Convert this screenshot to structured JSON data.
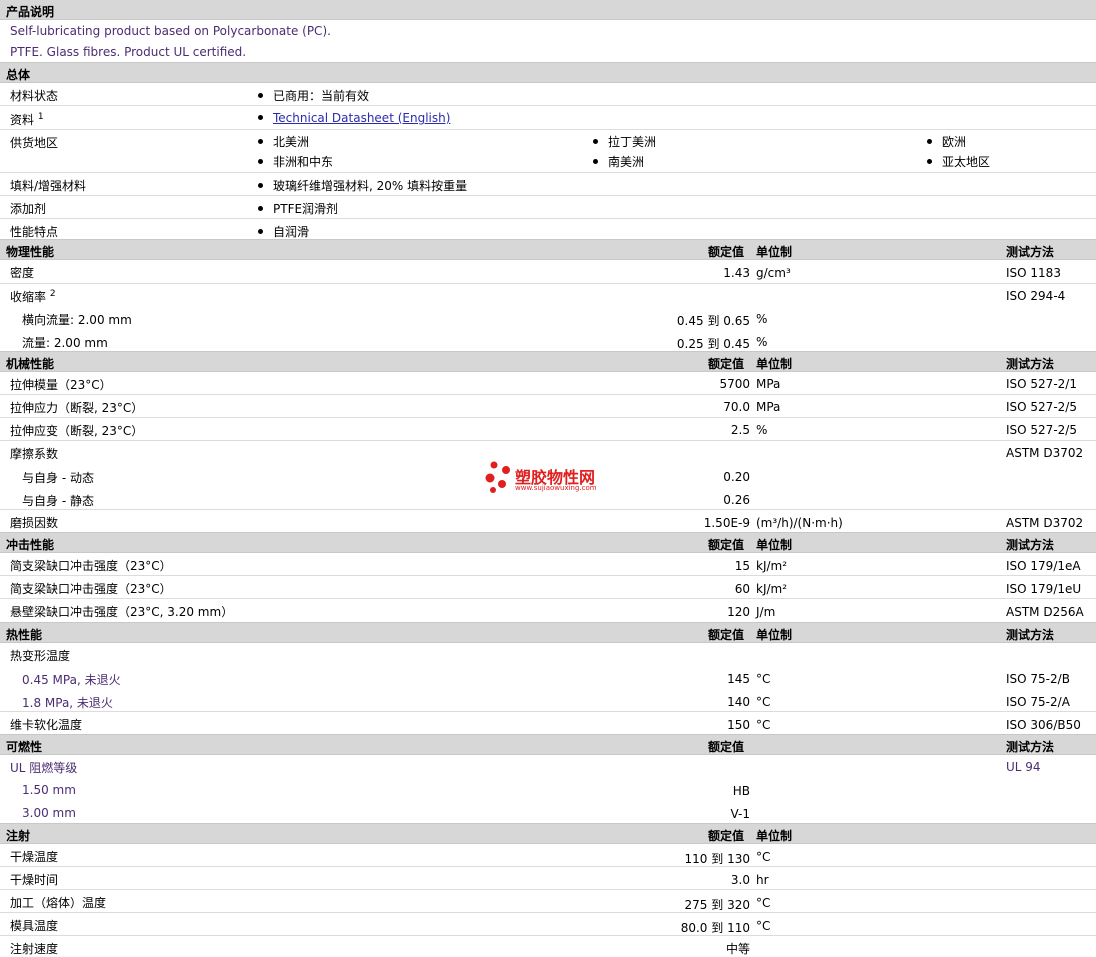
{
  "desc": {
    "title": "产品说明",
    "line1": "Self-lubricating product based on Polycarbonate (PC).",
    "line2": "PTFE. Glass fibres. Product UL certified."
  },
  "general": {
    "title": "总体",
    "status_label": "材料状态",
    "status_value": "已商用：当前有效",
    "docs_label": "资料",
    "docs_sup": "1",
    "docs_link": "Technical Datasheet (English)",
    "region_label": "供货地区",
    "regions": [
      "北美洲",
      "拉丁美洲",
      "欧洲",
      "非洲和中东",
      "南美洲",
      "亚太地区"
    ],
    "filler_label": "填料/增强材料",
    "filler_value": "玻璃纤维增强材料, 20% 填料按重量",
    "additive_label": "添加剂",
    "additive_value": "PTFE润滑剂",
    "feature_label": "性能特点",
    "feature_value": "自润滑"
  },
  "col": {
    "rated": "额定值",
    "unit": "单位制",
    "test": "测试方法"
  },
  "physical": {
    "title": "物理性能",
    "density": {
      "label": "密度",
      "value": "1.43",
      "unit": "g/cm³",
      "test": "ISO 1183"
    },
    "shrink": {
      "label": "收缩率",
      "sup": "2",
      "test": "ISO 294-4"
    },
    "shrink_t": {
      "label": "横向流量: 2.00 mm",
      "from": "0.45",
      "to": "到",
      "end": "0.65",
      "unit": "%"
    },
    "shrink_f": {
      "label": "流量: 2.00 mm",
      "from": "0.25",
      "to": "到",
      "end": "0.45",
      "unit": "%"
    }
  },
  "mechanical": {
    "title": "机械性能",
    "rows": [
      {
        "label": "拉伸模量（23°C）",
        "value": "5700",
        "unit": "MPa",
        "test": "ISO 527-2/1"
      },
      {
        "label": "拉伸应力（断裂, 23°C）",
        "value": "70.0",
        "unit": "MPa",
        "test": "ISO 527-2/5"
      },
      {
        "label": "拉伸应变（断裂, 23°C）",
        "value": "2.5",
        "unit": "%",
        "test": "ISO 527-2/5"
      }
    ],
    "friction": {
      "label": "摩擦系数",
      "test": "ASTM D3702"
    },
    "friction_dyn": {
      "label": "与自身 - 动态",
      "value": "0.20"
    },
    "friction_sta": {
      "label": "与自身 - 静态",
      "value": "0.26"
    },
    "wear": {
      "label": "磨损因数",
      "value": "1.50E-9",
      "unit": "(m³/h)/(N·m·h)",
      "test": "ASTM D3702"
    }
  },
  "impact": {
    "title": "冲击性能",
    "rows": [
      {
        "label": "简支梁缺口冲击强度（23°C）",
        "value": "15",
        "unit": "kJ/m²",
        "test": "ISO 179/1eA"
      },
      {
        "label": "简支梁缺口冲击强度（23°C）",
        "value": "60",
        "unit": "kJ/m²",
        "test": "ISO 179/1eU"
      },
      {
        "label": "悬壁梁缺口冲击强度（23°C, 3.20 mm）",
        "value": "120",
        "unit": "J/m",
        "test": "ASTM D256A"
      }
    ]
  },
  "thermal": {
    "title": "热性能",
    "hdt": {
      "label": "热变形温度"
    },
    "hdt1": {
      "label": "0.45 MPa, 未退火",
      "value": "145",
      "unit": "°C",
      "test": "ISO 75-2/B"
    },
    "hdt2": {
      "label": "1.8 MPa, 未退火",
      "value": "140",
      "unit": "°C",
      "test": "ISO 75-2/A"
    },
    "vicat": {
      "label": "维卡软化温度",
      "value": "150",
      "unit": "°C",
      "test": "ISO 306/B50"
    }
  },
  "flame": {
    "title": "可燃性",
    "ul": {
      "label": "UL 阻燃等级",
      "test": "UL 94"
    },
    "ul1": {
      "label": "1.50 mm",
      "value": "HB"
    },
    "ul2": {
      "label": "3.00 mm",
      "value": "V-1"
    }
  },
  "injection": {
    "title": "注射",
    "dry_temp": {
      "label": "干燥温度",
      "from": "110",
      "to": "到",
      "end": "130",
      "unit": "°C"
    },
    "dry_time": {
      "label": "干燥时间",
      "value": "3.0",
      "unit": "hr"
    },
    "melt_temp": {
      "label": "加工（熔体）温度",
      "from": "275",
      "to": "到",
      "end": "320",
      "unit": "°C"
    },
    "mold_temp": {
      "label": "模具温度",
      "from": "80.0",
      "to": "到",
      "end": "110",
      "unit": "°C"
    },
    "speed": {
      "label": "注射速度",
      "value": "中等"
    }
  },
  "watermark": {
    "name": "塑胶物性网",
    "url": "www.sujiaowuxing.com",
    "color": "#e02020"
  }
}
